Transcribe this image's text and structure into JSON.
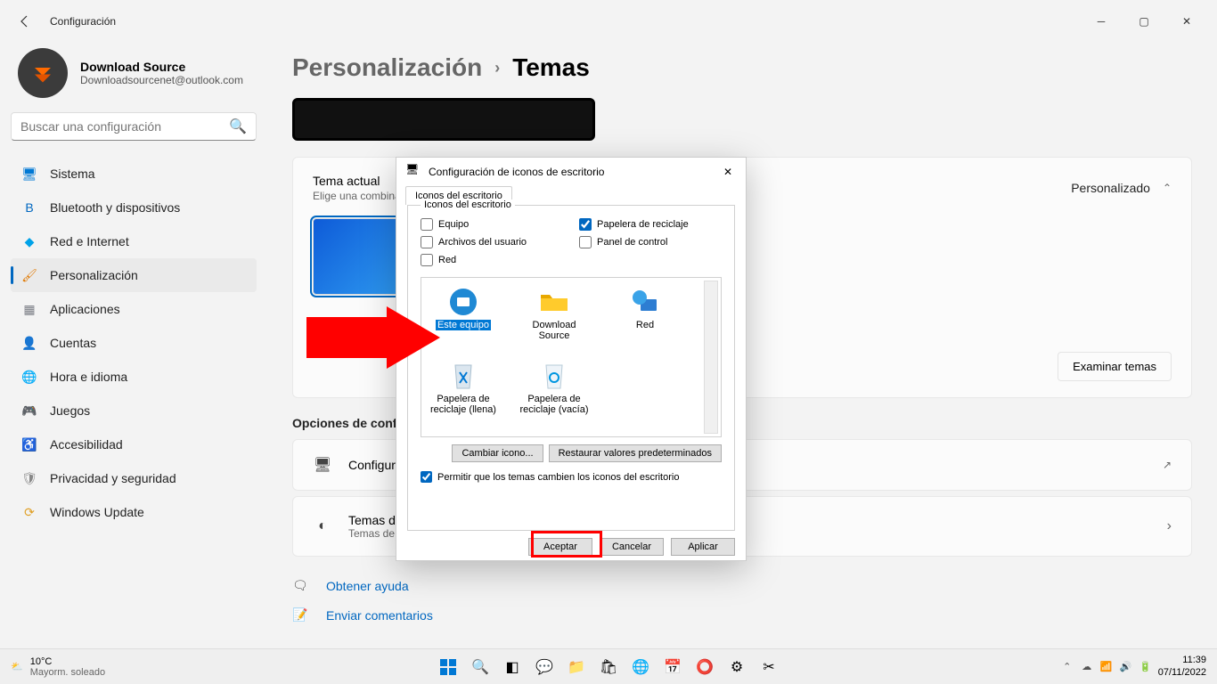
{
  "titlebar": {
    "app": "Configuración"
  },
  "profile": {
    "name": "Download Source",
    "email": "Downloadsourcenet@outlook.com"
  },
  "search": {
    "placeholder": "Buscar una configuración"
  },
  "nav": [
    {
      "icon": "🖥",
      "label": "Sistema",
      "color": "#0078d4"
    },
    {
      "icon": "B",
      "label": "Bluetooth y dispositivos",
      "color": "#0067c0"
    },
    {
      "icon": "◆",
      "label": "Red e Internet",
      "color": "#00a2e8"
    },
    {
      "icon": "🖌",
      "label": "Personalización",
      "color": "#e07800",
      "active": true
    },
    {
      "icon": "▦",
      "label": "Aplicaciones",
      "color": "#7a7d85"
    },
    {
      "icon": "👤",
      "label": "Cuentas",
      "color": "#2faa6d"
    },
    {
      "icon": "🌐",
      "label": "Hora e idioma",
      "color": "#3a7be0"
    },
    {
      "icon": "🎮",
      "label": "Juegos",
      "color": "#888"
    },
    {
      "icon": "♿",
      "label": "Accesibilidad",
      "color": "#3682c4"
    },
    {
      "icon": "🛡",
      "label": "Privacidad y seguridad",
      "color": "#888"
    },
    {
      "icon": "⟳",
      "label": "Windows Update",
      "color": "#e0a129"
    }
  ],
  "breadcrumb": {
    "root": "Personalización",
    "leaf": "Temas"
  },
  "currentTheme": {
    "title": "Tema actual",
    "subtitle": "Elige una combinación para darle a tu escritorio más personalidad",
    "status": "Personalizado",
    "browseBtn": "Examinar temas"
  },
  "sectionOptions": "Opciones de configuración",
  "rows": {
    "config": {
      "title": "Configuración de iconos del escritorio"
    },
    "contrast": {
      "title": "Temas de contraste",
      "sub": "Temas de color para visión reducida y sensibilidad a la luz"
    }
  },
  "links": {
    "help": "Obtener ayuda",
    "feedback": "Enviar comentarios"
  },
  "dialog": {
    "title": "Configuración de iconos de escritorio",
    "tab": "Iconos del escritorio",
    "group": "Iconos del escritorio",
    "cb": {
      "equipo": "Equipo",
      "papelera": "Papelera de reciclaje",
      "archivos": "Archivos del usuario",
      "panel": "Panel de control",
      "red": "Red"
    },
    "icons": {
      "equipo": "Este equipo",
      "ds": "Download Source",
      "red": "Red",
      "pll": "Papelera de reciclaje (llena)",
      "plv": "Papelera de reciclaje (vacía)"
    },
    "btnChange": "Cambiar icono...",
    "btnRestore": "Restaurar valores predeterminados",
    "permit": "Permitir que los temas cambien los iconos del escritorio",
    "accept": "Aceptar",
    "cancel": "Cancelar",
    "apply": "Aplicar"
  },
  "taskbar": {
    "temp": "10°C",
    "cond": "Mayorm. soleado",
    "time": "11:39",
    "date": "07/11/2022"
  }
}
